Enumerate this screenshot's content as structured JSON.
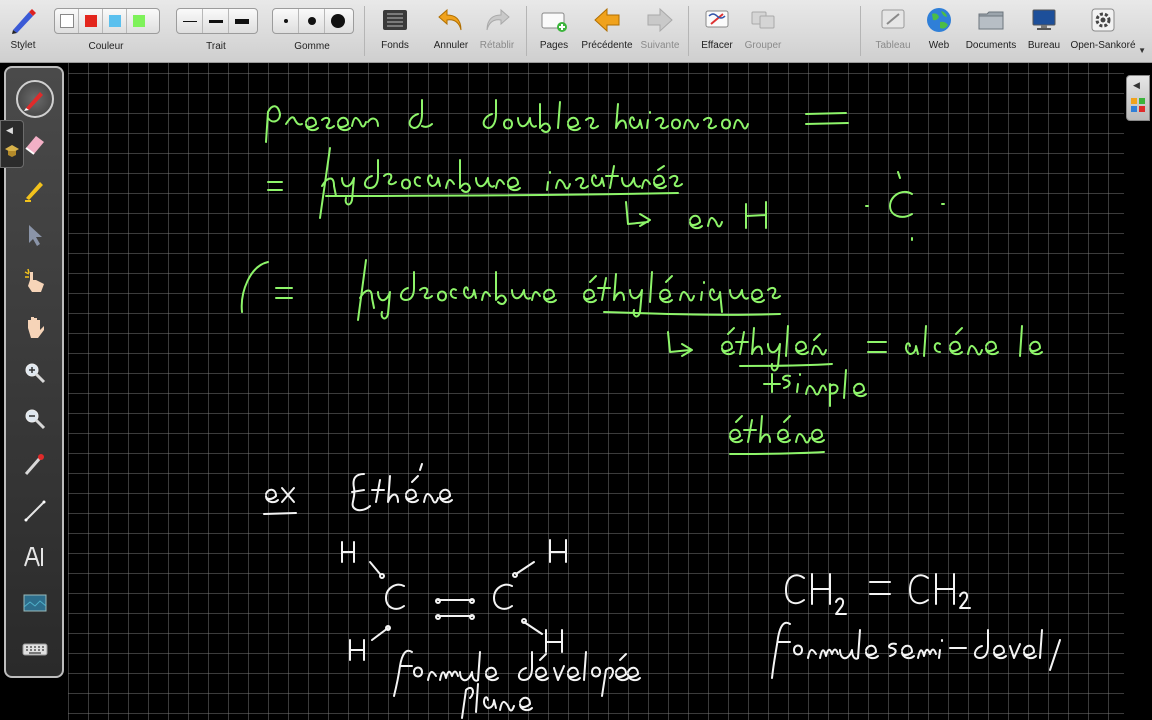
{
  "toolbar": {
    "stylet": "Stylet",
    "couleur": "Couleur",
    "trait": "Trait",
    "gomme": "Gomme",
    "fonds": "Fonds",
    "annuler": "Annuler",
    "retablir": "Rétablir",
    "pages": "Pages",
    "precedente": "Précédente",
    "suivante": "Suivante",
    "effacer": "Effacer",
    "grouper": "Grouper",
    "tableau": "Tableau",
    "web": "Web",
    "documents": "Documents",
    "bureau": "Bureau",
    "open_sankore": "Open-Sankoré",
    "colors": [
      "#ffffff",
      "#e3261d",
      "#5bc0ee",
      "#7ef25a"
    ]
  },
  "left_tools": [
    "pen-tool",
    "eraser-tool",
    "marker-tool",
    "selector-tool",
    "interact-tool",
    "hand-tool",
    "zoom-in-tool",
    "zoom-out-tool",
    "pointer-tool",
    "line-tool",
    "text-tool",
    "capture-tool",
    "keyboard-tool"
  ],
  "board": {
    "ink_green": "#8ef56a",
    "ink_white": "#f4f4f4",
    "line1": "présence de doubles liaisons",
    "line2": "= hydrocarbures insaturés",
    "line3": "en H",
    "line4": "C = hydrocarbures éthyléniques",
    "line5": "éthylène = alcène le + simple",
    "line6": "éthène",
    "example_label": "ex",
    "example_name": "Ethène",
    "formula_semi": "CH2 = CH2",
    "caption_developed": "formule développée plane",
    "caption_semi": "formule semi-dévelop."
  }
}
